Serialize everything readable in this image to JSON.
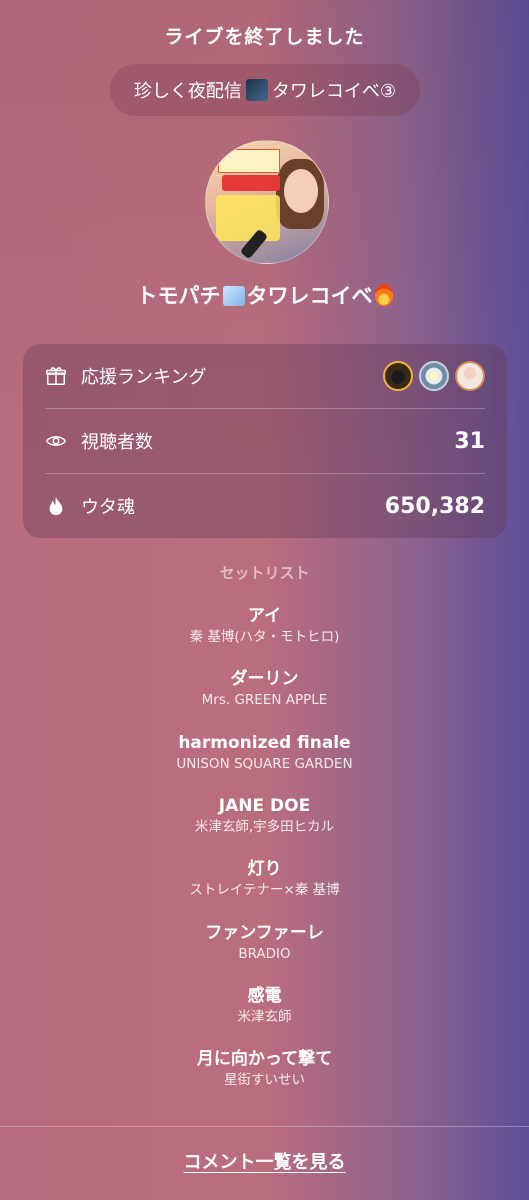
{
  "header": {
    "title": "ライブを終了しました"
  },
  "stream": {
    "title_prefix": "珍しく夜配信",
    "title_suffix": "タワレコイベ③"
  },
  "user": {
    "name_prefix": "トモパチ",
    "name_suffix": "タワレコイベ"
  },
  "stats": {
    "ranking_label": "応援ランキング",
    "viewers_label": "視聴者数",
    "viewers_value": "31",
    "soul_label": "ウタ魂",
    "soul_value": "650,382"
  },
  "setlist": {
    "heading": "セットリスト",
    "songs": [
      {
        "title": "アイ",
        "artist": "秦 基博(ハタ・モトヒロ)"
      },
      {
        "title": "ダーリン",
        "artist": "Mrs. GREEN APPLE"
      },
      {
        "title": "harmonized finale",
        "artist": "UNISON SQUARE GARDEN"
      },
      {
        "title": "JANE DOE",
        "artist": "米津玄師,宇多田ヒカル"
      },
      {
        "title": "灯り",
        "artist": "ストレイテナー×秦 基博"
      },
      {
        "title": "ファンファーレ",
        "artist": "BRADIO"
      },
      {
        "title": "感電",
        "artist": "米津玄師"
      },
      {
        "title": "月に向かって撃て",
        "artist": "星街すいせい"
      }
    ]
  },
  "footer": {
    "comments_link": "コメント一覧を見る"
  },
  "icons": [
    "gift-icon",
    "eye-icon",
    "flame-icon"
  ]
}
